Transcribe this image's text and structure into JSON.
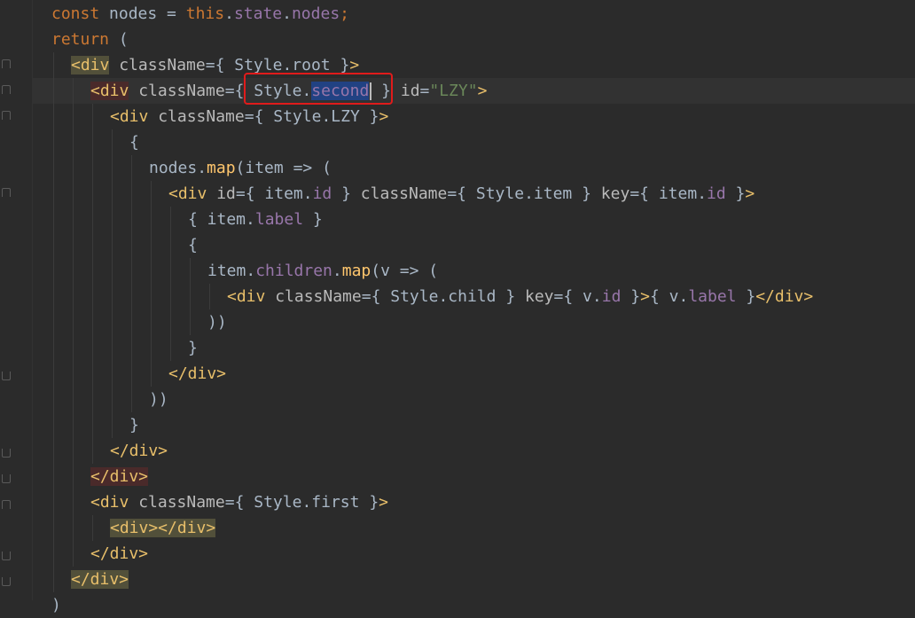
{
  "editor": {
    "lines": [
      {
        "indent": 1,
        "tokens": [
          {
            "t": "const",
            "c": "kw"
          },
          {
            "t": " nodes = ",
            "c": "plain"
          },
          {
            "t": "this",
            "c": "kw"
          },
          {
            "t": ".",
            "c": "plain"
          },
          {
            "t": "state",
            "c": "prop"
          },
          {
            "t": ".",
            "c": "plain"
          },
          {
            "t": "nodes",
            "c": "prop"
          },
          {
            "t": ";",
            "c": "kw"
          }
        ]
      },
      {
        "indent": 1,
        "tokens": [
          {
            "t": "return",
            "c": "kw"
          },
          {
            "t": " (",
            "c": "plain"
          }
        ]
      },
      {
        "indent": 2,
        "tokens": [
          {
            "t": "<div",
            "c": "tag",
            "bg": "olive"
          },
          {
            "t": " className",
            "c": "attr"
          },
          {
            "t": "={",
            "c": "punc"
          },
          {
            "t": " Style",
            "c": "plain"
          },
          {
            "t": ".",
            "c": "plain"
          },
          {
            "t": "root",
            "c": "plain"
          },
          {
            "t": " }",
            "c": "punc"
          },
          {
            "t": ">",
            "c": "tag"
          }
        ]
      },
      {
        "indent": 3,
        "caret": true,
        "tokens": [
          {
            "t": "<div",
            "c": "tag",
            "bg": "red"
          },
          {
            "t": " className",
            "c": "attr"
          },
          {
            "t": "={",
            "c": "punc"
          },
          {
            "t": " Style",
            "c": "plain"
          },
          {
            "t": ".",
            "c": "plain"
          },
          {
            "t": "second",
            "c": "prop",
            "bg": "sel"
          },
          {
            "t": "",
            "c": "caret"
          },
          {
            "t": " }",
            "c": "punc"
          },
          {
            "t": " id",
            "c": "attr"
          },
          {
            "t": "=",
            "c": "punc"
          },
          {
            "t": "\"LZY\"",
            "c": "str"
          },
          {
            "t": ">",
            "c": "tag"
          }
        ]
      },
      {
        "indent": 4,
        "tokens": [
          {
            "t": "<div",
            "c": "tag"
          },
          {
            "t": " className",
            "c": "attr"
          },
          {
            "t": "={",
            "c": "punc"
          },
          {
            "t": " Style",
            "c": "plain"
          },
          {
            "t": ".",
            "c": "plain"
          },
          {
            "t": "LZY",
            "c": "plain"
          },
          {
            "t": " }",
            "c": "punc"
          },
          {
            "t": ">",
            "c": "tag"
          }
        ]
      },
      {
        "indent": 5,
        "tokens": [
          {
            "t": "{",
            "c": "plain"
          }
        ]
      },
      {
        "indent": 6,
        "tokens": [
          {
            "t": "nodes",
            "c": "plain"
          },
          {
            "t": ".",
            "c": "plain"
          },
          {
            "t": "map",
            "c": "fn"
          },
          {
            "t": "(item => (",
            "c": "plain"
          }
        ]
      },
      {
        "indent": 7,
        "tokens": [
          {
            "t": "<div",
            "c": "tag"
          },
          {
            "t": " id",
            "c": "attr"
          },
          {
            "t": "={",
            "c": "punc"
          },
          {
            "t": " item",
            "c": "plain"
          },
          {
            "t": ".",
            "c": "plain"
          },
          {
            "t": "id",
            "c": "prop"
          },
          {
            "t": " }",
            "c": "punc"
          },
          {
            "t": " className",
            "c": "attr"
          },
          {
            "t": "={",
            "c": "punc"
          },
          {
            "t": " Style",
            "c": "plain"
          },
          {
            "t": ".",
            "c": "plain"
          },
          {
            "t": "item",
            "c": "plain"
          },
          {
            "t": " }",
            "c": "punc"
          },
          {
            "t": " key",
            "c": "attr"
          },
          {
            "t": "={",
            "c": "punc"
          },
          {
            "t": " item",
            "c": "plain"
          },
          {
            "t": ".",
            "c": "plain"
          },
          {
            "t": "id",
            "c": "prop"
          },
          {
            "t": " }",
            "c": "punc"
          },
          {
            "t": ">",
            "c": "tag"
          }
        ]
      },
      {
        "indent": 8,
        "tokens": [
          {
            "t": "{ item",
            "c": "plain"
          },
          {
            "t": ".",
            "c": "plain"
          },
          {
            "t": "label",
            "c": "prop"
          },
          {
            "t": " }",
            "c": "plain"
          }
        ]
      },
      {
        "indent": 8,
        "tokens": [
          {
            "t": "{",
            "c": "plain"
          }
        ]
      },
      {
        "indent": 9,
        "tokens": [
          {
            "t": "item",
            "c": "plain"
          },
          {
            "t": ".",
            "c": "plain"
          },
          {
            "t": "children",
            "c": "prop"
          },
          {
            "t": ".",
            "c": "plain"
          },
          {
            "t": "map",
            "c": "fn"
          },
          {
            "t": "(v => (",
            "c": "plain"
          }
        ]
      },
      {
        "indent": 10,
        "tokens": [
          {
            "t": "<div",
            "c": "tag"
          },
          {
            "t": " className",
            "c": "attr"
          },
          {
            "t": "={",
            "c": "punc"
          },
          {
            "t": " Style",
            "c": "plain"
          },
          {
            "t": ".",
            "c": "plain"
          },
          {
            "t": "child",
            "c": "plain"
          },
          {
            "t": " }",
            "c": "punc"
          },
          {
            "t": " key",
            "c": "attr"
          },
          {
            "t": "={",
            "c": "punc"
          },
          {
            "t": " v",
            "c": "plain"
          },
          {
            "t": ".",
            "c": "plain"
          },
          {
            "t": "id",
            "c": "prop"
          },
          {
            "t": " }",
            "c": "punc"
          },
          {
            "t": ">",
            "c": "tag"
          },
          {
            "t": "{ v",
            "c": "plain"
          },
          {
            "t": ".",
            "c": "plain"
          },
          {
            "t": "label",
            "c": "prop"
          },
          {
            "t": " }",
            "c": "plain"
          },
          {
            "t": "</div>",
            "c": "tag"
          }
        ]
      },
      {
        "indent": 9,
        "tokens": [
          {
            "t": "))",
            "c": "plain"
          }
        ]
      },
      {
        "indent": 8,
        "tokens": [
          {
            "t": "}",
            "c": "plain"
          }
        ]
      },
      {
        "indent": 7,
        "tokens": [
          {
            "t": "</div>",
            "c": "tag"
          }
        ]
      },
      {
        "indent": 6,
        "tokens": [
          {
            "t": "))",
            "c": "plain"
          }
        ]
      },
      {
        "indent": 5,
        "tokens": [
          {
            "t": "}",
            "c": "plain"
          }
        ]
      },
      {
        "indent": 4,
        "tokens": [
          {
            "t": "</div>",
            "c": "tag"
          }
        ]
      },
      {
        "indent": 3,
        "tokens": [
          {
            "t": "</div>",
            "c": "tag",
            "bg": "red"
          }
        ]
      },
      {
        "indent": 3,
        "tokens": [
          {
            "t": "<div",
            "c": "tag"
          },
          {
            "t": " className",
            "c": "attr"
          },
          {
            "t": "={",
            "c": "punc"
          },
          {
            "t": " Style",
            "c": "plain"
          },
          {
            "t": ".",
            "c": "plain"
          },
          {
            "t": "first",
            "c": "plain"
          },
          {
            "t": " }",
            "c": "punc"
          },
          {
            "t": ">",
            "c": "tag"
          }
        ]
      },
      {
        "indent": 4,
        "tokens": [
          {
            "t": "<div></div>",
            "c": "tag",
            "bg": "olive"
          }
        ]
      },
      {
        "indent": 3,
        "tokens": [
          {
            "t": "</div>",
            "c": "tag"
          }
        ]
      },
      {
        "indent": 2,
        "tokens": [
          {
            "t": "</div>",
            "c": "tag",
            "bg": "olive"
          }
        ]
      },
      {
        "indent": 1,
        "tokens": [
          {
            "t": ")",
            "c": "plain"
          }
        ]
      }
    ]
  },
  "colors": {
    "background": "#2b2b2b",
    "keyword": "#cc7832",
    "tag": "#e8bf6a",
    "string": "#6a8759",
    "property": "#9876aa",
    "function": "#ffc66d",
    "annotation": "#e01b1b"
  }
}
